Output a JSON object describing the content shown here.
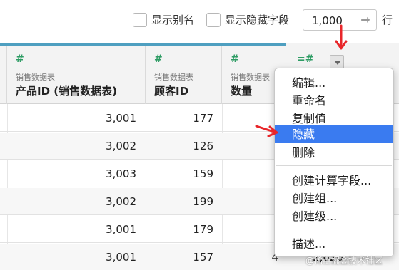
{
  "toolbar": {
    "show_alias_label": "显示别名",
    "show_hidden_label": "显示隐藏字段",
    "rows_value": "1,000",
    "rows_unit": "行",
    "rows_arrow_icon": "arrow-right-icon"
  },
  "columns": [
    {
      "source": "销售数据表",
      "name": "产品ID (销售数据表)",
      "type_icon": "#"
    },
    {
      "source": "销售数据表",
      "name": "顾客ID",
      "type_icon": "#"
    },
    {
      "source": "销售数据表",
      "name": "数量",
      "type_icon": "#"
    },
    {
      "source": "",
      "name": "",
      "type_icon": "=#"
    }
  ],
  "rows": [
    {
      "product_id": "3,001",
      "customer_id": "177",
      "qty": "",
      "extra": ""
    },
    {
      "product_id": "3,002",
      "customer_id": "126",
      "qty": "",
      "extra": ""
    },
    {
      "product_id": "3,003",
      "customer_id": "159",
      "qty": "",
      "extra": ""
    },
    {
      "product_id": "3,002",
      "customer_id": "199",
      "qty": "",
      "extra": ""
    },
    {
      "product_id": "3,001",
      "customer_id": "179",
      "qty": "",
      "extra": ""
    },
    {
      "product_id": "3,001",
      "customer_id": "157",
      "qty": "4",
      "extra": "2,020"
    }
  ],
  "context_menu": {
    "items": [
      "编辑...",
      "重命名",
      "复制值",
      "隐藏",
      "删除",
      "创建计算字段...",
      "创建组...",
      "创建级...",
      "描述..."
    ],
    "highlighted": "隐藏"
  },
  "colors": {
    "accent_bar": "#4e9fc0",
    "menu_highlight": "#3a7bf0",
    "annotation_arrow": "#e8262a",
    "number_icon": "#2e9c64"
  },
  "watermark": "@稀土掘金技术社区"
}
